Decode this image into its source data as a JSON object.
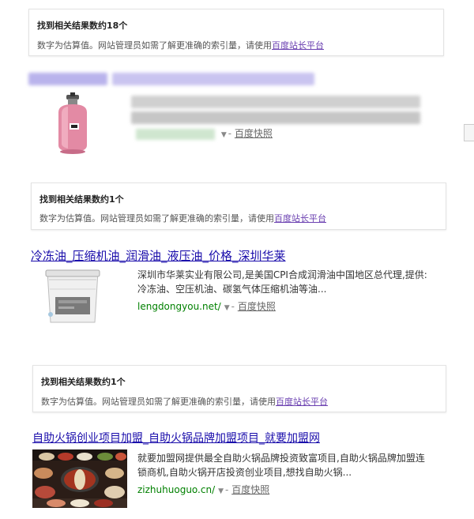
{
  "notices": [
    {
      "title": "找到相关结果数约18个",
      "desc_prefix": "数字为估算值。网站管理员如需了解更准确的索引量，请使用",
      "link_text": "百度站长平台"
    },
    {
      "title": "找到相关结果数约1个",
      "desc_prefix": "数字为估算值。网站管理员如需了解更准确的索引量，请使用",
      "link_text": "百度站长平台"
    },
    {
      "title": "找到相关结果数约1个",
      "desc_prefix": "数字为估算值。网站管理员如需了解更准确的索引量，请使用",
      "link_text": "百度站长平台"
    }
  ],
  "results": [
    {
      "title": "",
      "snippet_lines": [],
      "url": "",
      "snapshot": "百度快照"
    },
    {
      "title": "冷冻油_压缩机油_润滑油_液压油_价格_深圳华莱",
      "snippet_lines": [
        "深圳市华莱实业有限公司,是美国CPI合成润滑油中国地区总代理,提供:",
        "冷冻油、空压机油、碳氢气体压缩机油等油..."
      ],
      "url": "lengdongyou.net/",
      "snapshot": "百度快照"
    },
    {
      "title": "自助火锅创业项目加盟_自助火锅品牌加盟项目_就要加盟网",
      "snippet_lines": [
        "就要加盟网提供最全自助火锅品牌投资致富项目,自助火锅品牌加盟连",
        "锁商机,自助火锅开店投资创业项目,想找自助火锅..."
      ],
      "url": "zizhuhuoguo.cn/",
      "snapshot": "百度快照"
    }
  ],
  "colors": {
    "link": "#1a0dab",
    "url_green": "#008000",
    "notice_link": "#6a3fb0"
  },
  "icons": [
    "gas-cylinder-image",
    "oil-bucket-image",
    "hotpot-image",
    "dropdown-arrow-icon"
  ]
}
